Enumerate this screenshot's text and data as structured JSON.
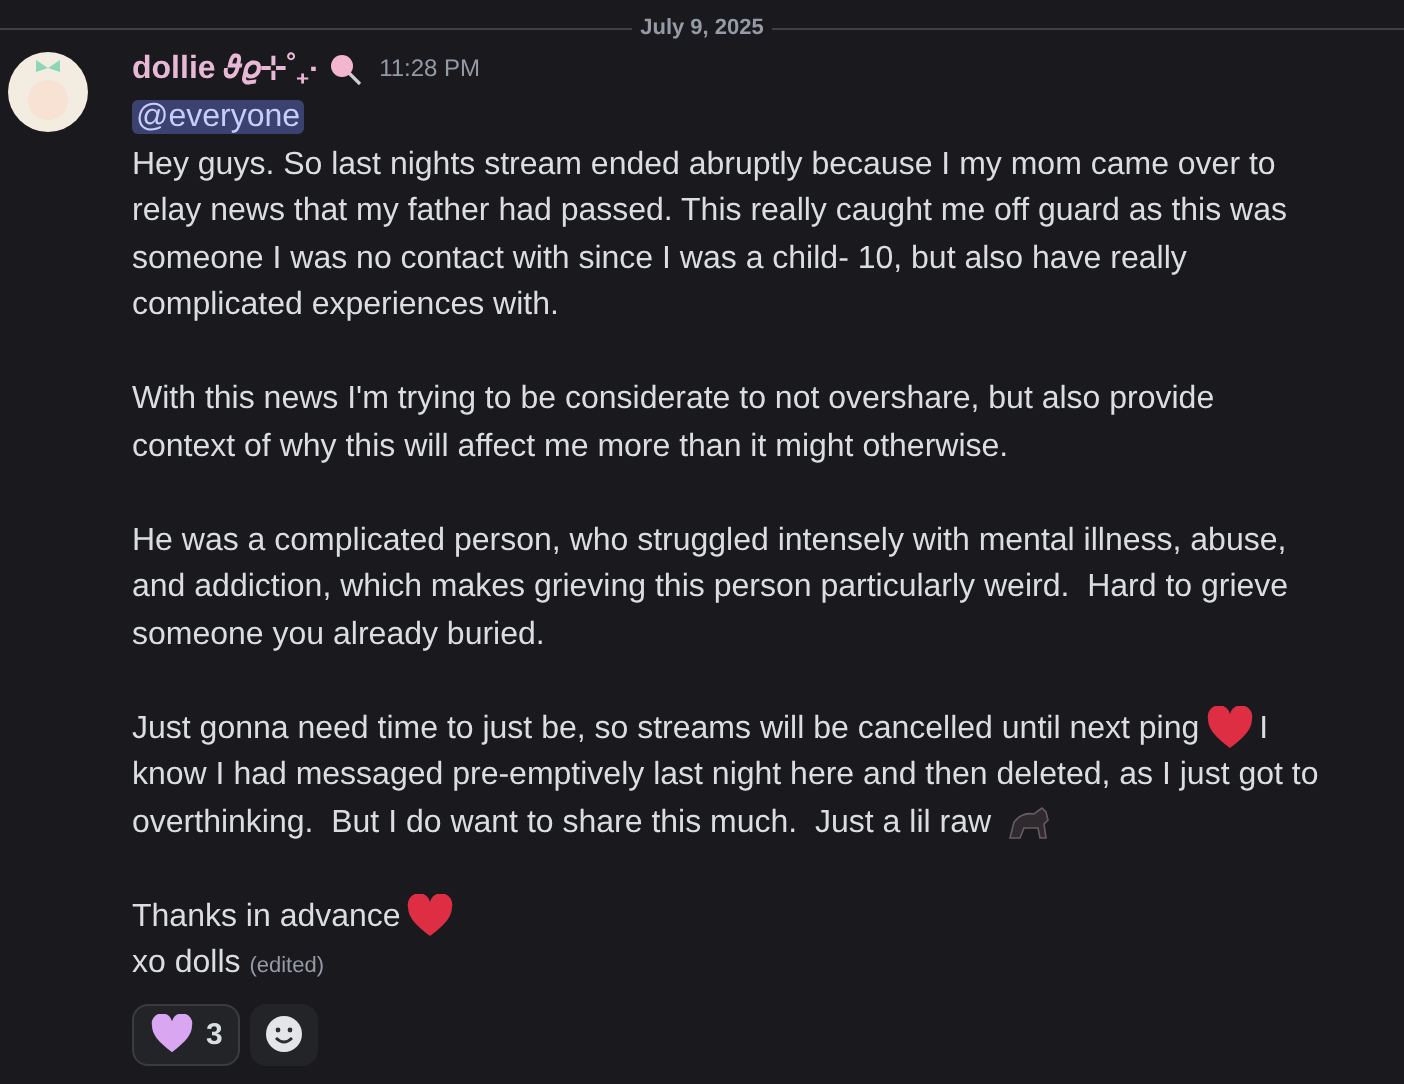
{
  "date_divider": "July 9, 2025",
  "message": {
    "author": "dollie 𝜗𝜚⊹˚₊‧",
    "timestamp": "11:28 PM",
    "mention": "@everyone",
    "paragraphs": [
      [
        [
          {
            "kind": "text",
            "text": "Hey guys. So last nights stream ended abruptly because I my mom came over to"
          }
        ],
        [
          {
            "kind": "text",
            "text": "relay news that my father had passed. This really caught me off guard as this was"
          }
        ],
        [
          {
            "kind": "text",
            "text": "someone I was no contact with since I was a child- 10, but also have really"
          }
        ],
        [
          {
            "kind": "text",
            "text": "complicated experiences with."
          }
        ]
      ],
      [
        [
          {
            "kind": "text",
            "text": "With this news I'm trying to be considerate to not overshare, but also provide"
          }
        ],
        [
          {
            "kind": "text",
            "text": "context of why this will affect me more than it might otherwise."
          }
        ]
      ],
      [
        [
          {
            "kind": "text",
            "text": "He was a complicated person, who struggled intensely with mental illness, abuse,"
          }
        ],
        [
          {
            "kind": "text",
            "text": "and addiction, which makes grieving this person particularly weird.  Hard to grieve"
          }
        ],
        [
          {
            "kind": "text",
            "text": "someone you already buried."
          }
        ]
      ],
      [
        [
          {
            "kind": "text",
            "text": "Just gonna need time to just be, so streams will be cancelled until next ping"
          },
          {
            "kind": "heart"
          },
          {
            "kind": "text",
            "text": "I"
          }
        ],
        [
          {
            "kind": "text",
            "text": "know I had messaged pre-emptively last night here and then deleted, as I just got to"
          }
        ],
        [
          {
            "kind": "text",
            "text": "overthinking.  But I do want to share this much.  Just a lil raw"
          },
          {
            "kind": "critter"
          }
        ]
      ],
      [
        [
          {
            "kind": "text",
            "text": "Thanks in advance"
          },
          {
            "kind": "heart"
          }
        ]
      ]
    ],
    "last_line": "xo dolls",
    "edited": "(edited)",
    "reactions": [
      {
        "count": "3",
        "selected": false
      }
    ]
  }
}
